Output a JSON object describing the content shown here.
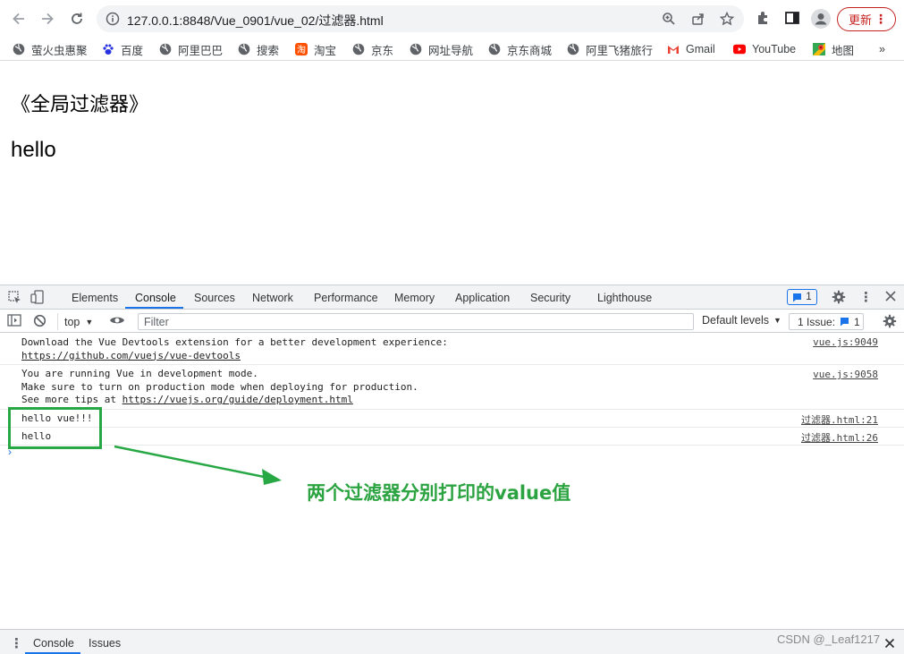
{
  "browser": {
    "url": "127.0.0.1:8848/Vue_0901/vue_02/过滤器.html",
    "update_label": "更新",
    "menu_dots": "⋮",
    "bookmarks": [
      {
        "label": "萤火虫惠聚",
        "icon": "globe-icon"
      },
      {
        "label": "百度",
        "icon": "baidu-paw-icon"
      },
      {
        "label": "阿里巴巴",
        "icon": "globe-icon"
      },
      {
        "label": "搜索",
        "icon": "globe-icon"
      },
      {
        "label": "淘宝",
        "icon": "taobao-icon"
      },
      {
        "label": "京东",
        "icon": "globe-icon"
      },
      {
        "label": "网址导航",
        "icon": "globe-icon"
      },
      {
        "label": "京东商城",
        "icon": "globe-icon"
      },
      {
        "label": "阿里飞猪旅行",
        "icon": "globe-icon"
      },
      {
        "label": "Gmail",
        "icon": "gmail-icon"
      },
      {
        "label": "YouTube",
        "icon": "youtube-icon"
      },
      {
        "label": "地图",
        "icon": "maps-icon"
      }
    ],
    "bookmarks_more": "»"
  },
  "page": {
    "heading": "《全局过滤器》",
    "hello": "hello"
  },
  "devtools": {
    "tabs": [
      "Elements",
      "Console",
      "Sources",
      "Network",
      "Performance",
      "Memory",
      "Application",
      "Security",
      "Lighthouse"
    ],
    "active_tab": "Console",
    "issues_badge_count": "1",
    "context": "top",
    "filter_placeholder": "Filter",
    "levels": "Default levels",
    "issue_label": "1 Issue:",
    "issue_count": "1",
    "messages": [
      {
        "lines": [
          "Download the Vue Devtools extension for a better development experience:"
        ],
        "link": "https://github.com/vuejs/vue-devtools",
        "source": "vue.js:9049"
      },
      {
        "lines": [
          "You are running Vue in development mode.",
          "Make sure to turn on production mode when deploying for production."
        ],
        "link_prefix": "See more tips at ",
        "link": "https://vuejs.org/guide/deployment.html",
        "source": "vue.js:9058"
      },
      {
        "lines": [
          "hello vue!!!"
        ],
        "source": "过滤器.html:21"
      },
      {
        "lines": [
          "hello"
        ],
        "source": "过滤器.html:26"
      }
    ],
    "prompt_symbol": "›",
    "drawer_tabs": [
      "Console",
      "Issues"
    ]
  },
  "annotation": {
    "text": "两个过滤器分别打印的value值",
    "color": "#2ba340"
  },
  "watermark": "CSDN @_Leaf1217"
}
